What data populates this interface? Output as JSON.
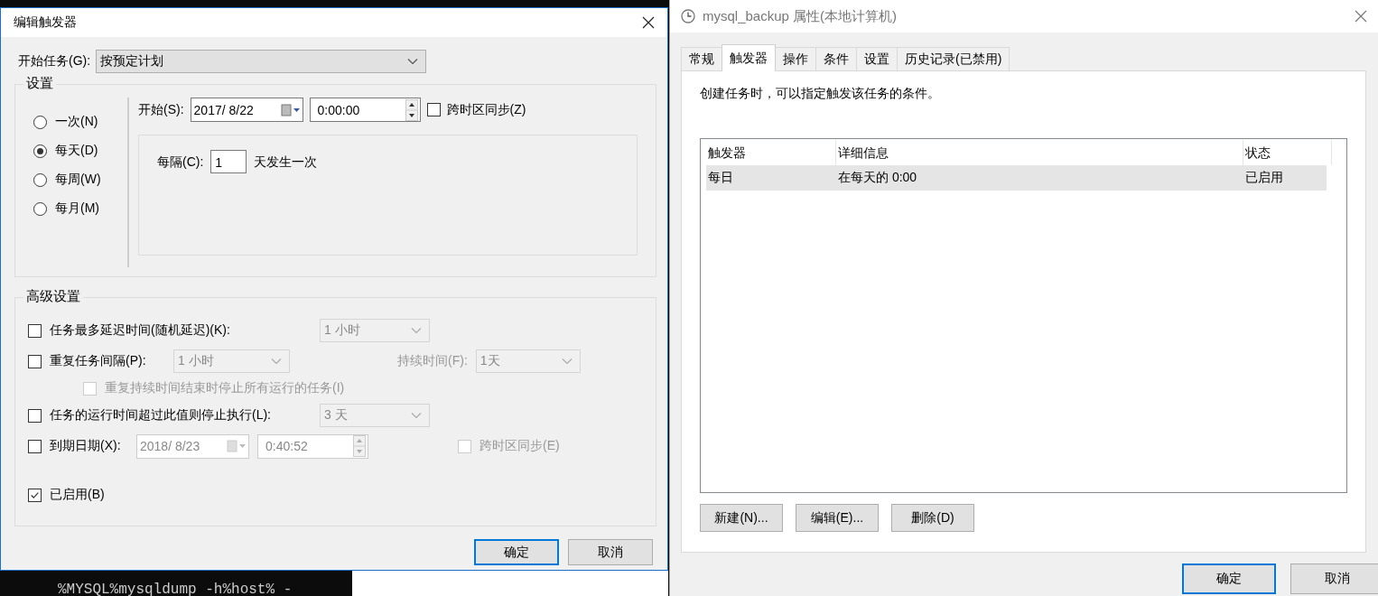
{
  "background": {
    "terminal_text": "%MYSQL%mysqldump -h%host% -"
  },
  "trigger_dialog": {
    "title": "编辑触发器",
    "start_task": {
      "label": "开始任务(G):",
      "value": "按预定计划"
    },
    "settings": {
      "title": "设置",
      "schedules": [
        {
          "label": "一次(N)",
          "selected": false
        },
        {
          "label": "每天(D)",
          "selected": true
        },
        {
          "label": "每周(W)",
          "selected": false
        },
        {
          "label": "每月(M)",
          "selected": false
        }
      ],
      "start": {
        "label": "开始(S):",
        "date": "2017/  8/22",
        "time": "0:00:00",
        "sync_label": "跨时区同步(Z)",
        "sync_checked": false
      },
      "recur": {
        "label": "每隔(C):",
        "value": "1",
        "suffix": "天发生一次"
      }
    },
    "advanced": {
      "title": "高级设置",
      "options": [
        {
          "kind": "combo",
          "label": "任务最多延迟时间(随机延迟)(K):",
          "checked": false,
          "value": "1 小时"
        },
        {
          "kind": "repeat",
          "label": "重复任务间隔(P):",
          "checked": false,
          "value": "1 小时",
          "duration_label": "持续时间(F):",
          "duration_value": "1天"
        },
        {
          "kind": "sub",
          "label": "重复持续时间结束时停止所有运行的任务(I)",
          "checked": false,
          "disabled": true
        },
        {
          "kind": "combo",
          "label": "任务的运行时间超过此值则停止执行(L):",
          "checked": false,
          "value": "3 天"
        },
        {
          "kind": "expiry",
          "label": "到期日期(X):",
          "checked": false,
          "date": "2018/  8/23",
          "time": "0:40:52",
          "sync_label": "跨时区同步(E)",
          "sync_checked": false,
          "sync_disabled": true
        },
        {
          "kind": "plain",
          "label": "已启用(B)",
          "checked": true
        }
      ]
    },
    "buttons": [
      {
        "label": "确定",
        "default": true
      },
      {
        "label": "取消",
        "default": false
      }
    ]
  },
  "properties_dialog": {
    "title": "mysql_backup 属性(本地计算机)",
    "tabs": [
      {
        "label": "常规",
        "selected": false
      },
      {
        "label": "触发器",
        "selected": true
      },
      {
        "label": "操作",
        "selected": false
      },
      {
        "label": "条件",
        "selected": false
      },
      {
        "label": "设置",
        "selected": false
      },
      {
        "label": "历史记录(已禁用)",
        "selected": false
      }
    ],
    "description": "创建任务时，可以指定触发该任务的条件。",
    "table": {
      "columns": [
        "触发器",
        "详细信息",
        "状态"
      ],
      "rows": [
        {
          "cells": [
            "每日",
            "在每天的 0:00",
            "已启用"
          ],
          "selected": true
        }
      ]
    },
    "actions": [
      "新建(N)...",
      "编辑(E)...",
      "删除(D)"
    ],
    "buttons": [
      {
        "label": "确定",
        "default": true
      },
      {
        "label": "取消",
        "default": false
      }
    ]
  }
}
